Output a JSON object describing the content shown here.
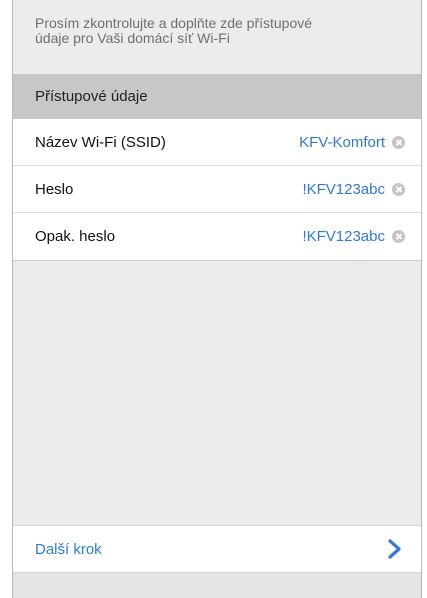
{
  "intro": {
    "line1": "Prosím zkontrolujte a doplňte zde přístupové",
    "line2": "údaje pro Vaši domácí síť Wi-Fi"
  },
  "section": {
    "title": "Přístupové údaje"
  },
  "fields": [
    {
      "label": "Název Wi-Fi (SSID)",
      "value": "KFV-Komfort"
    },
    {
      "label": "Heslo",
      "value": "!KFV123abc"
    },
    {
      "label": "Opak. heslo",
      "value": "!KFV123abc"
    }
  ],
  "footer": {
    "next_label": "Další krok",
    "next_icon": "chevron-right-icon"
  },
  "colors": {
    "accent": "#2f7bd1",
    "section_bg": "#c7c7c7",
    "page_bg": "#ebebeb"
  }
}
